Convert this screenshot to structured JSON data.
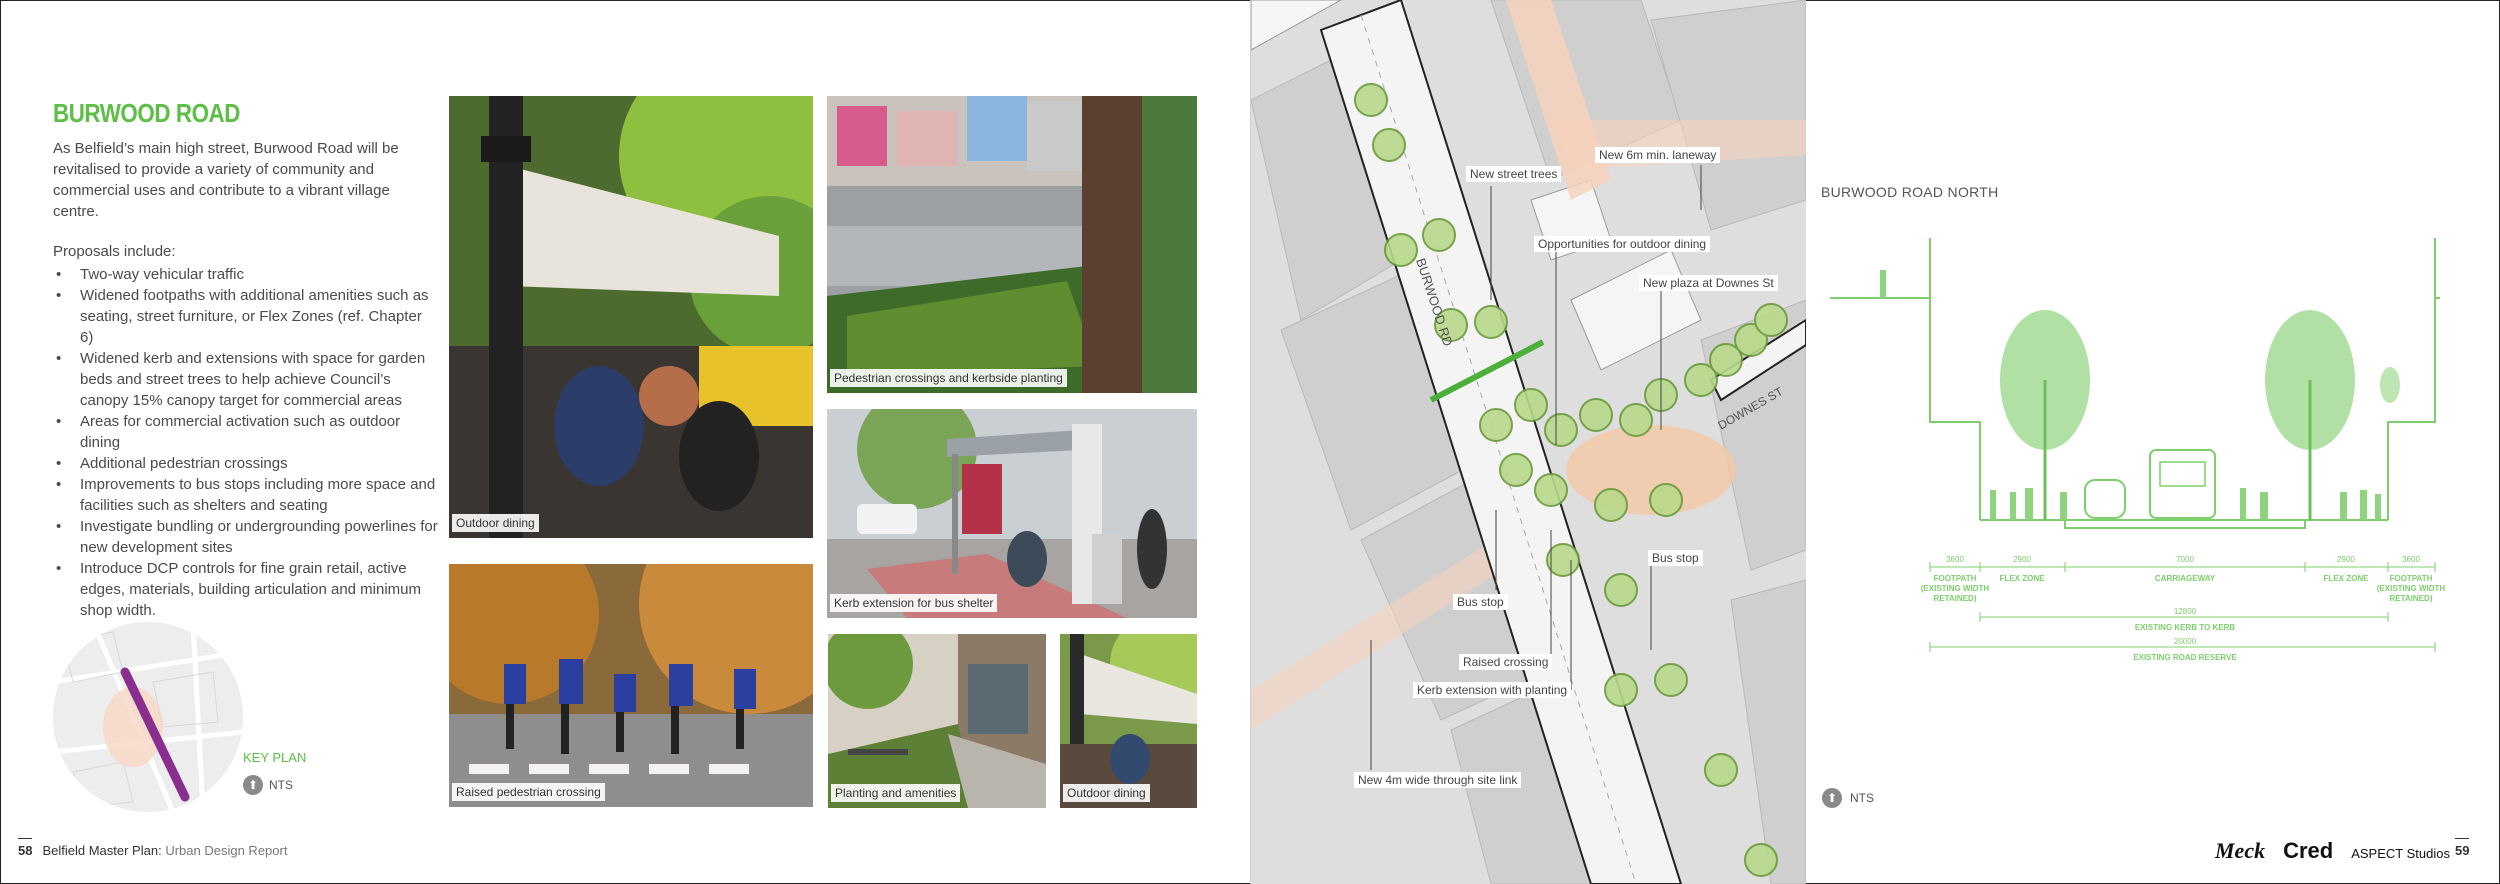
{
  "left_page": {
    "title": "BURWOOD ROAD",
    "intro": "As Belfield’s main high street, Burwood Road will be revitalised to provide a variety of community and commercial uses and contribute to a vibrant village centre.",
    "proposals_heading": "Proposals include:",
    "proposals": [
      "Two-way vehicular traffic",
      "Widened footpaths with additional amenities such as seating, street furniture, or Flex Zones (ref. Chapter 6)",
      "Widened kerb and extensions with space for garden beds and street trees to help achieve Council’s canopy 15% canopy target for commercial areas",
      "Areas for commercial activation such as outdoor dining",
      "Additional pedestrian crossings",
      "Improvements to bus stops including more space and facilities such as shelters and seating",
      "Investigate bundling or undergrounding powerlines for new development sites",
      "Introduce DCP controls for fine grain retail, active edges, materials, building articulation and minimum shop width."
    ],
    "key_plan_label": "KEY PLAN",
    "nts": "NTS",
    "page_number": "58",
    "footer_bold": "Belfield Master Plan:",
    "footer_light": "Urban Design Report"
  },
  "photos": {
    "outdoor_dining_1": "Outdoor dining",
    "pedestrian_kerbside": "Pedestrian crossings and kerbside planting",
    "kerb_bus_shelter": "Kerb extension for bus shelter",
    "raised_crossing": "Raised pedestrian crossing",
    "planting_amenities": "Planting and amenities",
    "outdoor_dining_2": "Outdoor dining"
  },
  "map": {
    "labels": {
      "new_street_trees": "New street trees",
      "new_laneway": "New 6m min. laneway",
      "outdoor_dining": "Opportunities for outdoor dining",
      "new_plaza": "New plaza at Downes St",
      "bus_stop_left": "Bus stop",
      "bus_stop_right": "Bus stop",
      "raised_crossing": "Raised crossing",
      "kerb_extension": "Kerb extension with planting",
      "site_link": "New 4m wide through site link",
      "burwood_rd": "BURWOOD RD",
      "downes_st": "DOWNES ST"
    }
  },
  "right_page": {
    "section_title": "BURWOOD ROAD NORTH",
    "dims": {
      "footpath_left_val": "3600",
      "footpath_left_label": "FOOTPATH (EXISTING WIDTH RETAINED)",
      "flex_left_val": "2900",
      "flex_left_label": "FLEX ZONE",
      "carriageway_val": "7000",
      "carriageway_label": "CARRIAGEWAY",
      "flex_right_val": "2900",
      "flex_right_label": "FLEX ZONE",
      "footpath_right_val": "3600",
      "footpath_right_label": "FOOTPATH (EXISTING WIDTH RETAINED)",
      "kerb_val": "12800",
      "kerb_label": "EXISTING KERB TO KERB",
      "reserve_val": "20000",
      "reserve_label": "EXISTING ROAD RESERVE"
    },
    "nts": "NTS",
    "page_number": "59",
    "logos": {
      "meck": "Meck",
      "cred": "Cred",
      "aspect": "ASPECT Studios"
    }
  },
  "colors": {
    "accent_green": "#5bbf44",
    "section_green": "#7ccf6c",
    "keyplan_purple": "#8a2f8f"
  }
}
